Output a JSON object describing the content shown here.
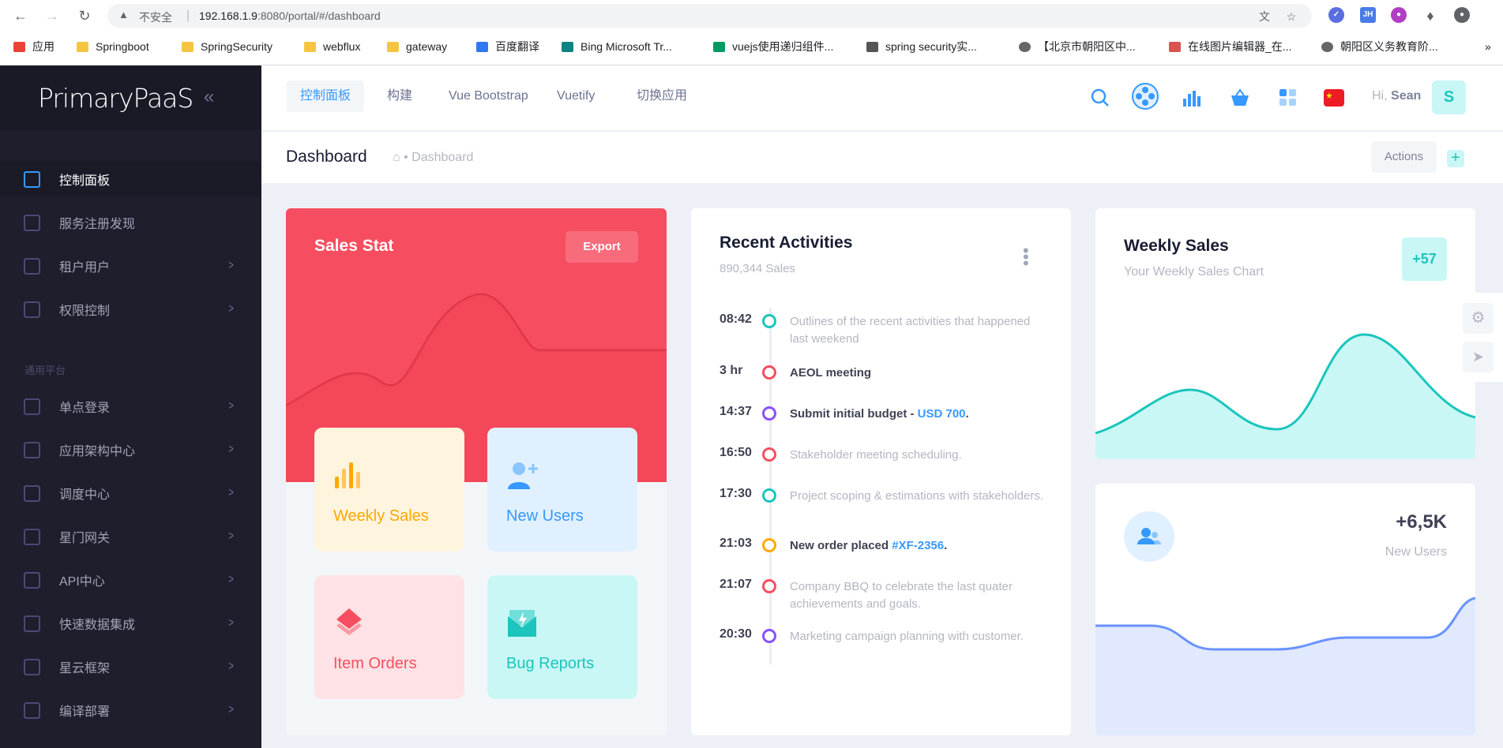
{
  "browser": {
    "security_label": "不安全",
    "url_host": "192.168.1.9",
    "url_rest": ":8080/portal/#/dashboard",
    "bookmarks": [
      "应用",
      "Springboot",
      "SpringSecurity",
      "webflux",
      "gateway",
      "百度翻译",
      "Bing Microsoft Tr...",
      "vuejs使用递归组件...",
      "spring security实...",
      "【北京市朝阳区中...",
      "在线图片编辑器_在...",
      "朝阳区义务教育阶..."
    ]
  },
  "sidebar": {
    "logo": "PrimaryPaaS",
    "section_label": "通用平台",
    "items": [
      {
        "label": "控制面板"
      },
      {
        "label": "服务注册发现"
      },
      {
        "label": "租户用户"
      },
      {
        "label": "权限控制"
      },
      {
        "label": "单点登录"
      },
      {
        "label": "应用架构中心"
      },
      {
        "label": "调度中心"
      },
      {
        "label": "星门网关"
      },
      {
        "label": "API中心"
      },
      {
        "label": "快速数据集成"
      },
      {
        "label": "星云框架"
      },
      {
        "label": "编译部署"
      }
    ]
  },
  "header": {
    "tabs": [
      {
        "label": "控制面板"
      },
      {
        "label": "构建"
      },
      {
        "label": "Vue Bootstrap"
      },
      {
        "label": "Vuetify"
      },
      {
        "label": "切换应用"
      }
    ],
    "greeting": "Hi,",
    "user_name": "Sean",
    "avatar_letter": "S"
  },
  "subheader": {
    "title": "Dashboard",
    "breadcrumb": "Dashboard",
    "actions_label": "Actions",
    "add_label": "+"
  },
  "sales_stat": {
    "title": "Sales Stat",
    "export_label": "Export",
    "tiles": [
      {
        "label": "Weekly Sales",
        "color": "#ffa800",
        "bg": "#fff4de"
      },
      {
        "label": "New Users",
        "color": "#3699ff",
        "bg": "#e1f0ff"
      },
      {
        "label": "Item Orders",
        "color": "#f64e60",
        "bg": "#ffe2e5"
      },
      {
        "label": "Bug Reports",
        "color": "#1bc5bd",
        "bg": "#c9f7f5"
      }
    ]
  },
  "recent_activities": {
    "title": "Recent Activities",
    "subtitle": "890,344 Sales",
    "items": [
      {
        "time": "08:42",
        "text": "Outlines of the recent activities that happened last weekend",
        "color": "#1bc5bd",
        "bold": false,
        "link": ""
      },
      {
        "time": "3 hr",
        "text": "AEOL meeting",
        "color": "#f64e60",
        "bold": true,
        "link": ""
      },
      {
        "time": "14:37",
        "text": "Submit initial budget - ",
        "color": "#8950fc",
        "bold": true,
        "link": "USD 700",
        "suffix": "."
      },
      {
        "time": "16:50",
        "text": "Stakeholder meeting scheduling.",
        "color": "#f64e60",
        "bold": false,
        "link": ""
      },
      {
        "time": "17:30",
        "text": "Project scoping & estimations with stakeholders.",
        "color": "#1bc5bd",
        "bold": false,
        "link": ""
      },
      {
        "time": "21:03",
        "text": "New order placed ",
        "color": "#ffa800",
        "bold": true,
        "link": "#XF-2356",
        "suffix": "."
      },
      {
        "time": "21:07",
        "text": "Company BBQ to celebrate the last quater achievements and goals.",
        "color": "#f64e60",
        "bold": false,
        "link": ""
      },
      {
        "time": "20:30",
        "text": "Marketing campaign planning with customer.",
        "color": "#8950fc",
        "bold": false,
        "link": ""
      }
    ]
  },
  "weekly_sales": {
    "title": "Weekly Sales",
    "subtitle": "Your Weekly Sales Chart",
    "badge": "+57"
  },
  "new_users": {
    "value": "+6,5K",
    "label": "New Users"
  }
}
